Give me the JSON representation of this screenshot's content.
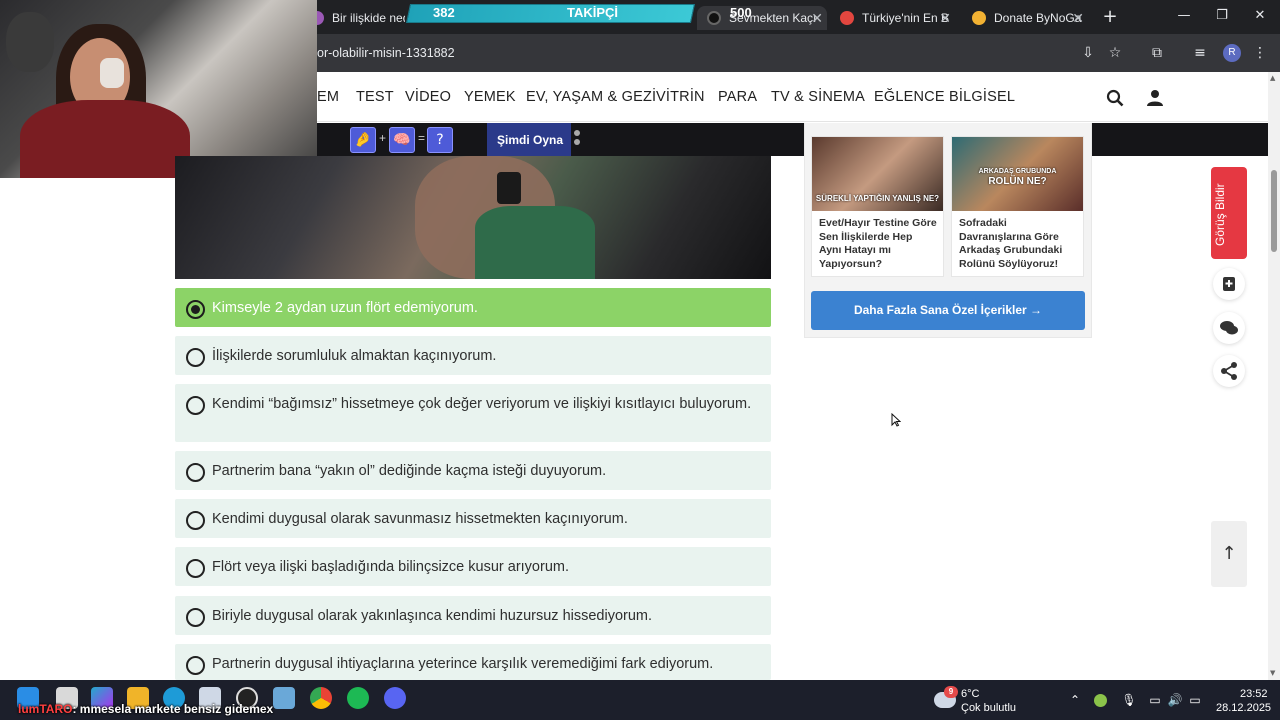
{
  "browser": {
    "tabs": [
      {
        "label": "Bir ilişkide neden"
      },
      {
        "label": "Sevmekten Kaçı"
      },
      {
        "label": "Türkiye'nin En B"
      },
      {
        "label": "Donate ByNoGa"
      }
    ],
    "url": "or-olabilir-misin-1331882",
    "profile_initial": "R"
  },
  "stream_overlay": {
    "follower_current": "382",
    "follower_label": "TAKİPÇİ",
    "follower_goal": "500",
    "chat_user": "lumTARO",
    "chat_message": ": mmesela markete bensiz gidemex"
  },
  "site": {
    "nav_items": [
      "EM",
      "TEST",
      "VİDEO",
      "YEMEK",
      "EV, YAŞAM & GEZİ",
      "VİTRİN",
      "PARA",
      "TV & SİNEMA",
      "EĞLENCE",
      "BİLGİSEL"
    ],
    "game_bar": {
      "emoji_1": "🤌",
      "emoji_2": "🧠",
      "plus": "+",
      "equals": "=",
      "unknown": "?",
      "play_label": "Şimdi Oyna"
    },
    "quiz": {
      "options": [
        {
          "text": "Kimseyle 2 aydan uzun flört edemiyorum.",
          "selected": true
        },
        {
          "text": "İlişkilerde sorumluluk almaktan kaçınıyorum.",
          "selected": false
        },
        {
          "text": "Kendimi “bağımsız” hissetmeye çok değer veriyorum ve ilişkiyi kısıtlayıcı buluyorum.",
          "selected": false
        },
        {
          "text": "Partnerim bana “yakın ol” dediğinde kaçma isteği duyuyorum.",
          "selected": false
        },
        {
          "text": "Kendimi duygusal olarak savunmasız hissetmekten kaçınıyorum.",
          "selected": false
        },
        {
          "text": "Flört veya ilişki başladığında bilinçsizce kusur arıyorum.",
          "selected": false
        },
        {
          "text": "Biriyle duygusal olarak yakınlaşınca kendimi huzursuz hissediyorum.",
          "selected": false
        },
        {
          "text": "Partnerin duygusal ihtiyaçlarına yeterince karşılık veremediğimi fark ediyorum.",
          "selected": false
        }
      ]
    },
    "sidebar": {
      "cards": [
        {
          "thumb_caption": "SÜREKLİ YAPTIĞIN YANLIŞ NE?",
          "title": "Evet/Hayır Testine Göre Sen İlişkilerde Hep Aynı Hatayı mı Yapıyorsun?"
        },
        {
          "thumb_caption_small": "ARKADAŞ GRUBUNDA",
          "thumb_caption": "ROLÜN NE?",
          "title": "Sofradaki Davranışlarına Göre Arkadaş Grubundaki Rolünü Söylüyoruz!"
        }
      ],
      "more_button": "Daha Fazla Sana Özel İçerikler →"
    },
    "feedback_label": "Görüş Bildir",
    "to_top": "↑"
  },
  "taskbar": {
    "weather_badge": "9",
    "weather_temp": "6°C",
    "weather_desc": "Çok bulutlu",
    "time": "23:52",
    "date": "28.12.2025"
  },
  "colors": {
    "selected_option": "#8cd367",
    "option_bg": "#e9f3ef",
    "more_button": "#3b82d1",
    "feedback": "#e53842",
    "follower_bar": "#1fa2b8"
  }
}
